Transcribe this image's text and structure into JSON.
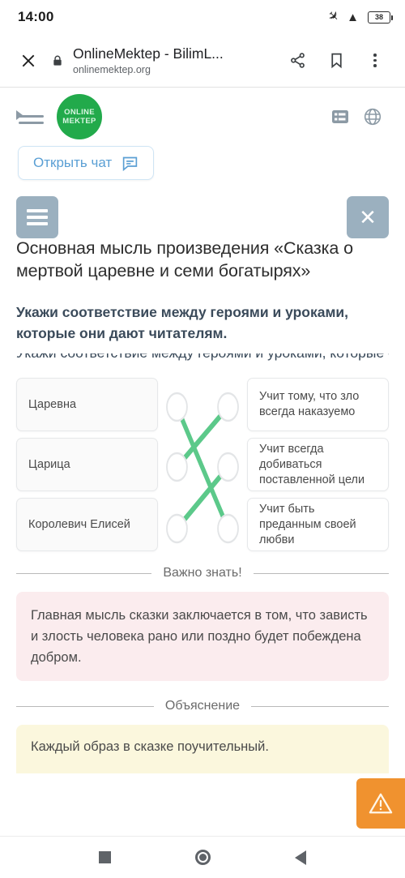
{
  "status_bar": {
    "time": "14:00",
    "airplane_icon": "airplane-mode-icon",
    "wifi_icon": "wifi-icon",
    "battery_level": "38"
  },
  "browser_bar": {
    "close_icon": "close-icon",
    "lock_icon": "lock-icon",
    "page_title": "OnlineMektep - BilimL...",
    "page_url": "onlinemektep.org",
    "share_icon": "share-icon",
    "bookmark_icon": "bookmark-icon",
    "overflow_icon": "more-vertical-icon"
  },
  "site_header": {
    "menu_icon": "indent-menu-icon",
    "logo_line1": "ONLINE",
    "logo_line2": "MEKTEP",
    "logo_color": "#22aa4b",
    "list_icon": "list-view-icon",
    "globe_icon": "globe-language-icon"
  },
  "chat": {
    "label": "Открыть чат",
    "icon": "chat-bubble-icon",
    "accent_color": "#5a9fd4"
  },
  "exercise": {
    "menu_button_icon": "hamburger-icon",
    "close_button_icon": "close-icon",
    "button_color": "#9bb0bf",
    "title": "Основная мысль произведения «Сказка о мертвой царевне и семи богатырях»",
    "instruction": "Укажи соответствие между героями и уроками, которые они дают читателям.",
    "clipped_line": "Укажи соответствие между героями и уроками, которые они дают читателям.",
    "left_items": [
      {
        "label": "Царевна"
      },
      {
        "label": "Царица"
      },
      {
        "label": "Королевич Елисей"
      }
    ],
    "right_items": [
      {
        "label": "Учит тому, что зло всегда наказуемо"
      },
      {
        "label": "Учит всегда добиваться поставленной цели"
      },
      {
        "label": "Учит быть преданным своей любви"
      }
    ],
    "connections": [
      {
        "from": 0,
        "to": 2
      },
      {
        "from": 1,
        "to": 0
      },
      {
        "from": 2,
        "to": 1
      }
    ],
    "line_color": "#5cc98a"
  },
  "important": {
    "heading": "Важно знать!",
    "text": "Главная мысль сказки заключается в том, что зависть и злость человека рано или поздно будет побеждена добром."
  },
  "explanation": {
    "heading": "Объяснение",
    "text": "Каждый образ в сказке поучительный."
  },
  "report_fab": {
    "icon": "warning-triangle-icon",
    "color": "#f0922f"
  },
  "android_nav": {
    "recents_icon": "square-recents-icon",
    "home_icon": "circle-home-icon",
    "back_icon": "triangle-back-icon"
  }
}
